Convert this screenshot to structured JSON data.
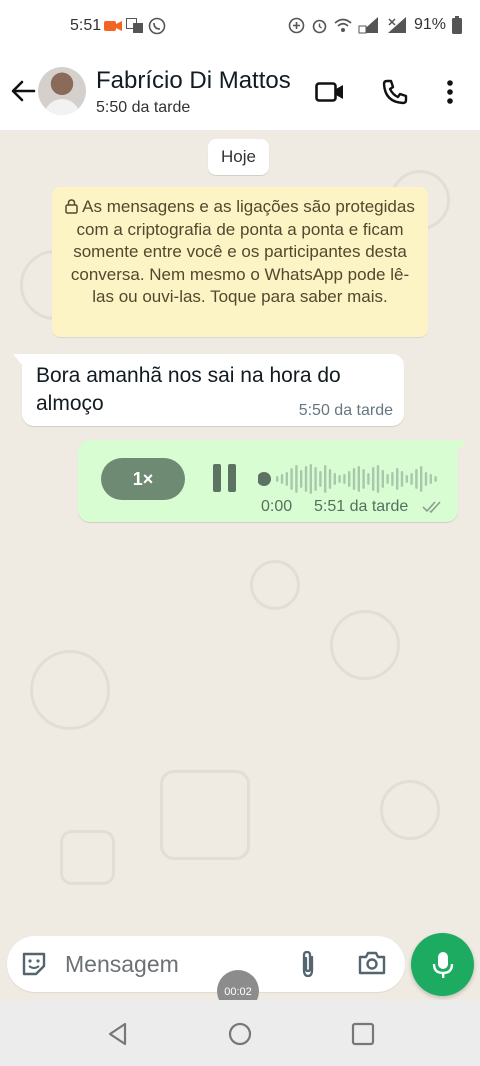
{
  "status_bar": {
    "time": "5:51",
    "battery": "91%"
  },
  "header": {
    "contact_name": "Fabrício Di Mattos",
    "last_seen": "5:50 da tarde",
    "icons": [
      "back-arrow-icon",
      "avatar",
      "video-call-icon",
      "phone-icon",
      "more-vert-icon"
    ]
  },
  "chat": {
    "date_chip": "Hoje",
    "encryption_notice": "As mensagens e as ligações são protegidas com a criptografia de ponta a ponta e ficam somente entre você e os participantes desta conversa. Nem mesmo o WhatsApp pode lê-las ou ouvi-las. Toque para saber mais.",
    "messages": [
      {
        "direction": "incoming",
        "text": "Bora amanhã nos sai na hora do almoço",
        "time": "5:50 da tarde"
      },
      {
        "direction": "outgoing",
        "type": "voice",
        "speed": "1×",
        "duration": "0:00",
        "time": "5:51 da tarde",
        "status": "delivered"
      }
    ]
  },
  "composer": {
    "placeholder": "Mensagem",
    "recording_timer": "00:02"
  },
  "colors": {
    "chat_background": "#efeae2",
    "outgoing_bubble": "#d9fdd3",
    "notice_background": "#fdf4c5",
    "accent_green": "#1daa61"
  }
}
